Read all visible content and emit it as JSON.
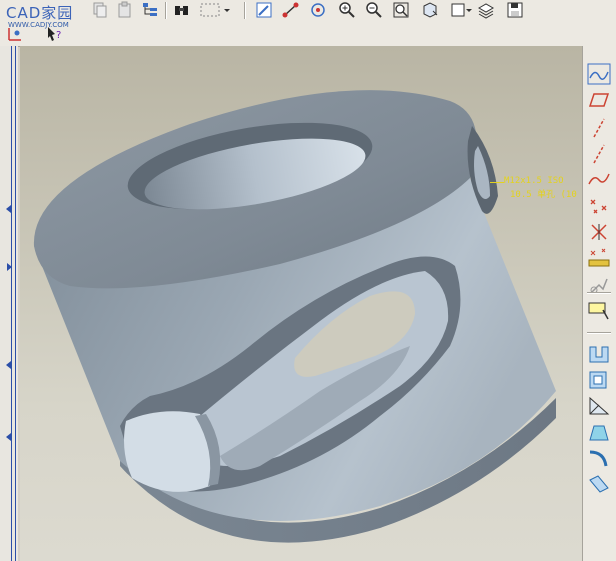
{
  "logo": {
    "main": "CAD家园",
    "url": "WWW.CADJY.COM"
  },
  "toolbar": {
    "icons": [
      "copy-icon",
      "paste-icon",
      "tree-icon",
      "binoculars-icon",
      "select-box-icon",
      "sketch-icon",
      "datum-icon",
      "spin-icon",
      "zoom-in-icon",
      "zoom-out-icon",
      "zoom-fit-icon",
      "view-icon",
      "saved-view-icon",
      "layers-icon",
      "save-icon"
    ]
  },
  "annotation": {
    "line1": "M12x1.5 ISO",
    "line2": "10.5 单孔 (10"
  },
  "colors": {
    "viewport_top": "#b9b5a4",
    "viewport_bottom": "#dcdad0",
    "model": "#9aa7b3",
    "annotation": "#e3d21f"
  }
}
